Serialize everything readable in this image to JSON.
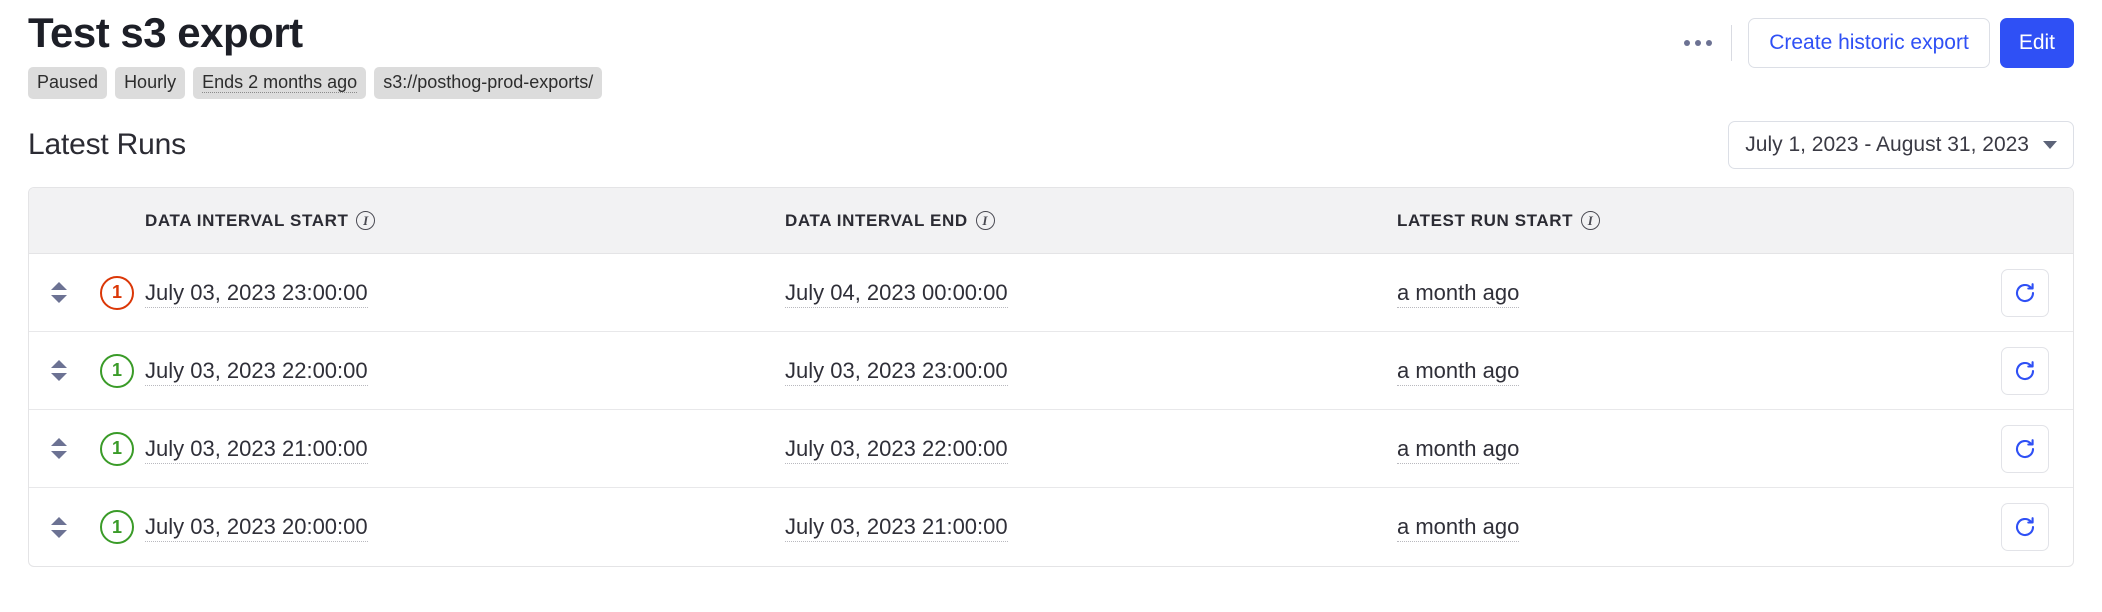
{
  "header": {
    "title": "Test s3 export",
    "badges": [
      {
        "text": "Paused",
        "dotted": false
      },
      {
        "text": "Hourly",
        "dotted": false
      },
      {
        "text": "Ends 2 months ago",
        "dotted": true
      },
      {
        "text": "s3://posthog-prod-exports/",
        "dotted": false
      }
    ],
    "more_menu_label": "…",
    "create_historic_export_label": "Create historic export",
    "edit_label": "Edit"
  },
  "section": {
    "title": "Latest Runs",
    "date_range": "July 1, 2023 - August 31, 2023"
  },
  "table": {
    "columns": [
      {
        "label": "DATA INTERVAL START",
        "info": true
      },
      {
        "label": "DATA INTERVAL END",
        "info": true
      },
      {
        "label": "LATEST RUN START",
        "info": true
      }
    ],
    "rows": [
      {
        "status_count": "1",
        "status_color": "#db3707",
        "data_interval_start": "July 03, 2023 23:00:00",
        "data_interval_end": "July 04, 2023 00:00:00",
        "latest_run_start": "a month ago"
      },
      {
        "status_count": "1",
        "status_color": "#3a9b28",
        "data_interval_start": "July 03, 2023 22:00:00",
        "data_interval_end": "July 03, 2023 23:00:00",
        "latest_run_start": "a month ago"
      },
      {
        "status_count": "1",
        "status_color": "#3a9b28",
        "data_interval_start": "July 03, 2023 21:00:00",
        "data_interval_end": "July 03, 2023 22:00:00",
        "latest_run_start": "a month ago"
      },
      {
        "status_count": "1",
        "status_color": "#3a9b28",
        "data_interval_start": "July 03, 2023 20:00:00",
        "data_interval_end": "July 03, 2023 21:00:00",
        "latest_run_start": "a month ago"
      }
    ]
  },
  "colors": {
    "primary": "#2f50f5",
    "error": "#db3707",
    "success": "#3a9b28",
    "badge_bg": "#dcdcdc",
    "header_bg": "#f2f2f3"
  },
  "icons": {
    "more": "ellipsis-horizontal-icon",
    "caret": "chevron-down-icon",
    "expand": "expand-collapse-icon",
    "retry": "refresh-icon",
    "info": "info-icon"
  }
}
